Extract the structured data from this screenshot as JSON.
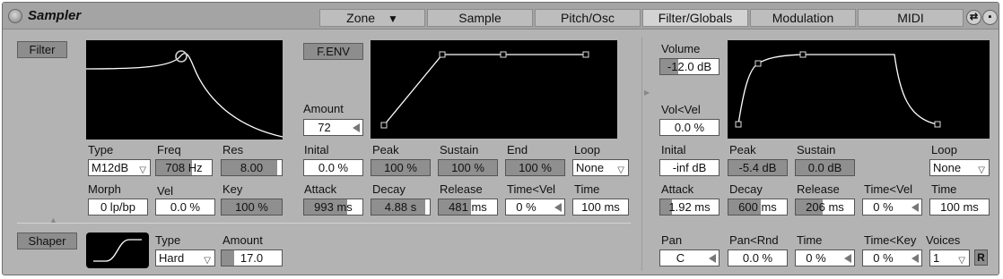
{
  "device": {
    "title": "Sampler"
  },
  "tabs": [
    {
      "label": "Zone",
      "chevron": "▼"
    },
    {
      "label": "Sample"
    },
    {
      "label": "Pitch/Osc"
    },
    {
      "label": "Filter/Globals"
    },
    {
      "label": "Modulation"
    },
    {
      "label": "MIDI"
    }
  ],
  "filter": {
    "button": "Filter",
    "type": {
      "label": "Type",
      "value": "M12dB"
    },
    "freq": {
      "label": "Freq",
      "value": "708 Hz"
    },
    "res": {
      "label": "Res",
      "value": "8.00"
    },
    "morph": {
      "label": "Morph",
      "value": "0 lp/bp"
    },
    "vel": {
      "label": "Vel",
      "value": "0.0 %"
    },
    "key": {
      "label": "Key",
      "value": "100 %"
    }
  },
  "fenv": {
    "button": "F.ENV",
    "amount": {
      "label": "Amount",
      "value": "72"
    },
    "initial": {
      "label": "Inital",
      "value": "0.0 %"
    },
    "peak": {
      "label": "Peak",
      "value": "100 %"
    },
    "sustain": {
      "label": "Sustain",
      "value": "100 %"
    },
    "end": {
      "label": "End",
      "value": "100 %"
    },
    "loop": {
      "label": "Loop",
      "value": "None"
    },
    "attack": {
      "label": "Attack",
      "value": "993 ms"
    },
    "decay": {
      "label": "Decay",
      "value": "4.88 s"
    },
    "release": {
      "label": "Release",
      "value": "481 ms"
    },
    "time_vel": {
      "label": "Time<Vel",
      "value": "0 %"
    },
    "time": {
      "label": "Time",
      "value": "100 ms"
    }
  },
  "shaper": {
    "button": "Shaper",
    "type": {
      "label": "Type",
      "value": "Hard"
    },
    "amount": {
      "label": "Amount",
      "value": "17.0"
    }
  },
  "volume_env": {
    "volume": {
      "label": "Volume",
      "value": "-12.0 dB"
    },
    "vol_vel": {
      "label": "Vol<Vel",
      "value": "0.0 %"
    },
    "initial": {
      "label": "Inital",
      "value": "-inf dB"
    },
    "peak": {
      "label": "Peak",
      "value": "-5.4 dB"
    },
    "sustain": {
      "label": "Sustain",
      "value": "0.0 dB"
    },
    "loop": {
      "label": "Loop",
      "value": "None"
    },
    "attack": {
      "label": "Attack",
      "value": "1.92 ms"
    },
    "decay": {
      "label": "Decay",
      "value": "600 ms"
    },
    "release": {
      "label": "Release",
      "value": "206 ms"
    },
    "time_vel": {
      "label": "Time<Vel",
      "value": "0 %"
    },
    "time": {
      "label": "Time",
      "value": "100 ms"
    }
  },
  "globals": {
    "pan": {
      "label": "Pan",
      "value": "C"
    },
    "pan_rnd": {
      "label": "Pan<Rnd",
      "value": "0.0 %"
    },
    "time": {
      "label": "Time",
      "value": "0 %"
    },
    "time_key": {
      "label": "Time<Key",
      "value": "0 %"
    },
    "voices": {
      "label": "Voices",
      "value": "1"
    },
    "retrigger": "R"
  },
  "icons": {
    "power": "power-icon",
    "hot_swap": "hot-swap-icon",
    "save": "save-preset-icon"
  },
  "colors": {
    "panel": "#b3b3b3",
    "display": "#000000",
    "curve": "#ffffff",
    "field": "#ffffff",
    "field_dark": "#8f8f8f"
  }
}
